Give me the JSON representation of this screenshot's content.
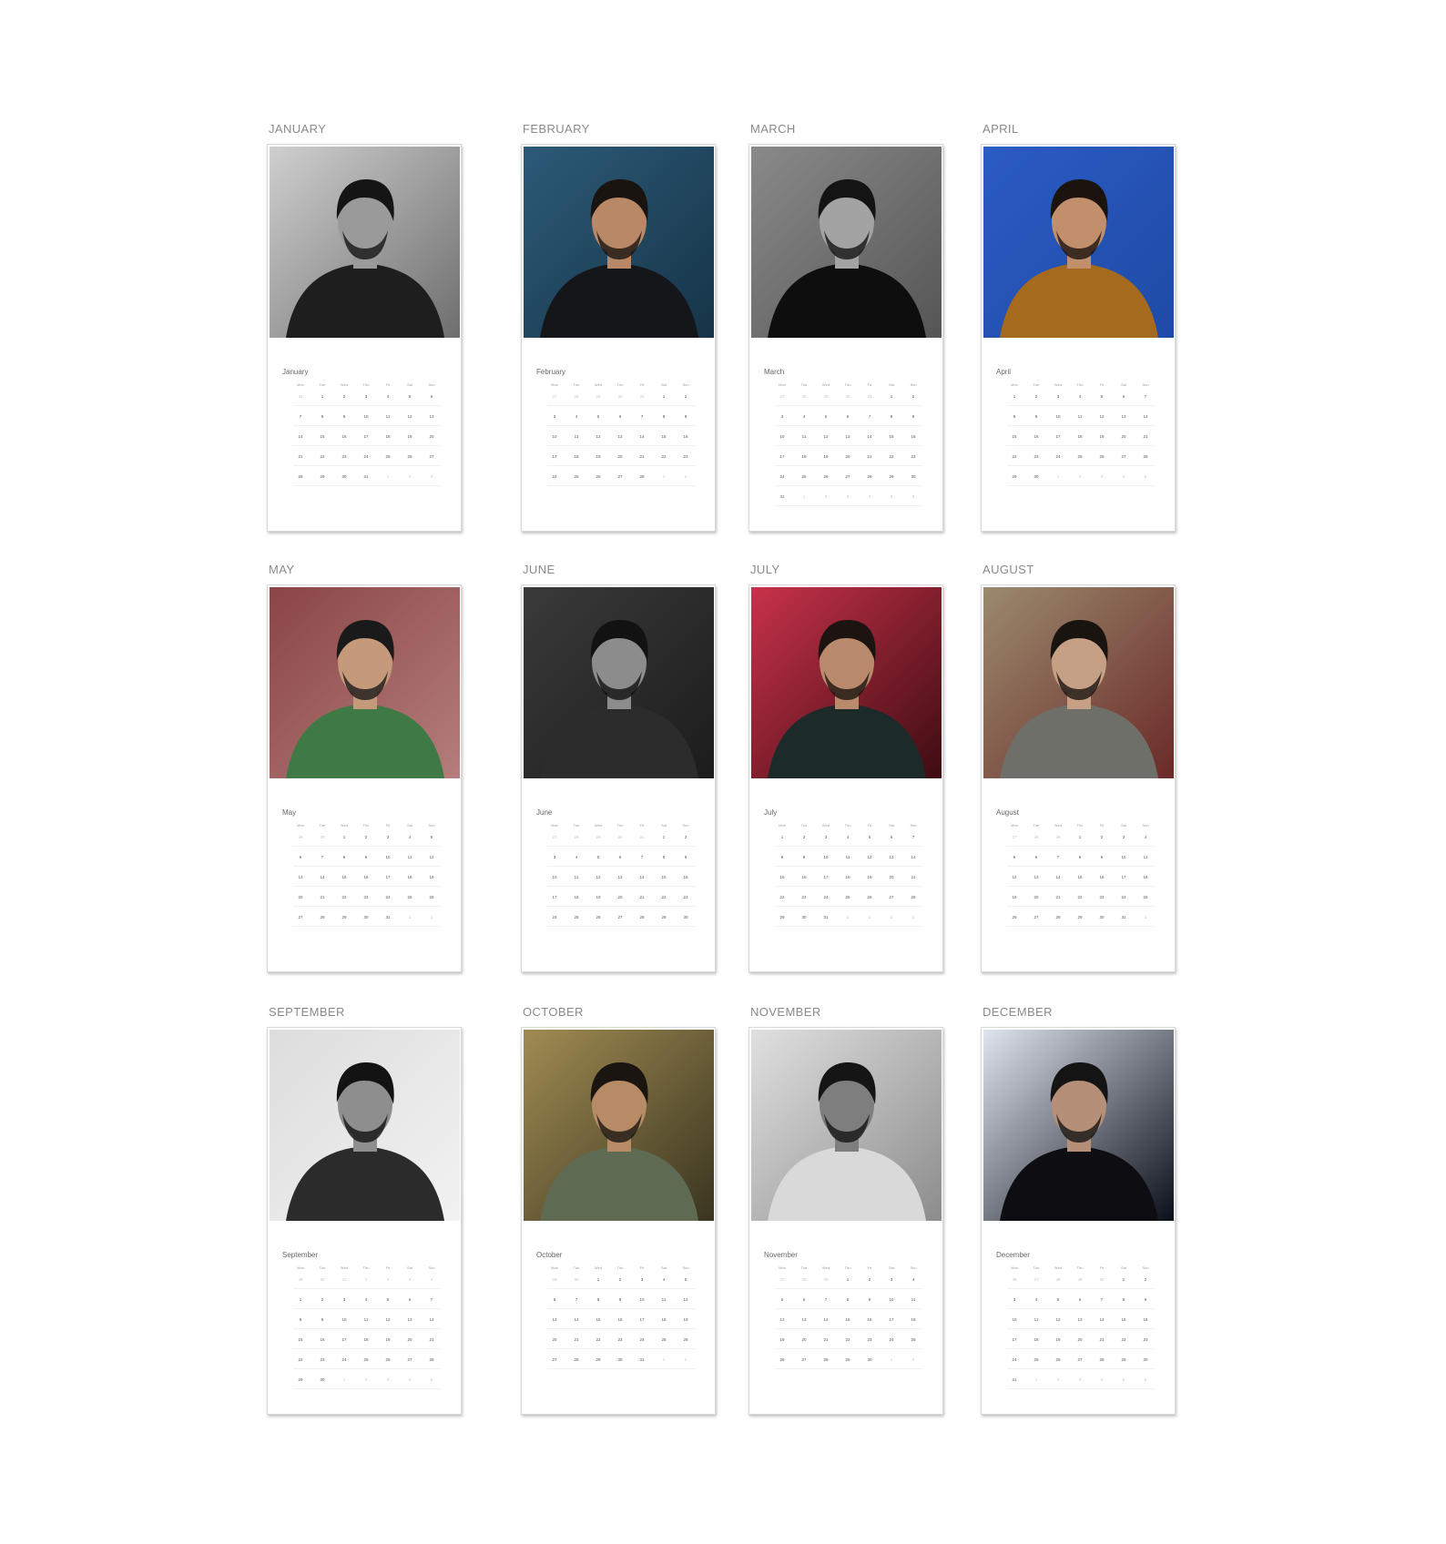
{
  "weekdays": [
    "Mon",
    "Tue",
    "Wed",
    "Thu",
    "Fri",
    "Sat",
    "Sun"
  ],
  "months": [
    {
      "heading": "JANUARY",
      "title": "January",
      "lead": [
        "31"
      ],
      "days": 31,
      "bw": true,
      "palette": {
        "bg": "#6e6e6e",
        "bg2": "#cfcfcf",
        "coat": "#1e1e1e",
        "skin": "#9a9a9a",
        "hair": "#151515"
      }
    },
    {
      "heading": "FEBRUARY",
      "title": "February",
      "lead": [
        "27",
        "28",
        "29",
        "30",
        "31"
      ],
      "days": 28,
      "bw": false,
      "palette": {
        "bg": "#163447",
        "bg2": "#2c5a78",
        "coat": "#14161a",
        "skin": "#b98867",
        "hair": "#1a1410"
      }
    },
    {
      "heading": "MARCH",
      "title": "March",
      "lead": [
        "27",
        "28",
        "29",
        "30",
        "31"
      ],
      "days": 31,
      "bw": true,
      "palette": {
        "bg": "#555555",
        "bg2": "#8a8a8a",
        "coat": "#0e0e0e",
        "skin": "#a3a3a3",
        "hair": "#141414"
      }
    },
    {
      "heading": "APRIL",
      "title": "April",
      "lead": [],
      "days": 30,
      "bw": false,
      "palette": {
        "bg": "#1f4aa6",
        "bg2": "#2b5cc4",
        "coat": "#a66a1f",
        "skin": "#c28f6d",
        "hair": "#1b130e"
      }
    },
    {
      "heading": "MAY",
      "title": "May",
      "lead": [
        "29",
        "30"
      ],
      "days": 31,
      "bw": false,
      "palette": {
        "bg": "#b57d7d",
        "bg2": "#8a4545",
        "coat": "#3f7a46",
        "skin": "#c49a7b",
        "hair": "#1a1a1a"
      }
    },
    {
      "heading": "JUNE",
      "title": "June",
      "lead": [
        "27",
        "28",
        "29",
        "30",
        "31"
      ],
      "days": 30,
      "bw": true,
      "palette": {
        "bg": "#1c1c1c",
        "bg2": "#3a3a3a",
        "coat": "#2c2c2c",
        "skin": "#8c8c8c",
        "hair": "#121212"
      }
    },
    {
      "heading": "JULY",
      "title": "July",
      "lead": [],
      "days": 31,
      "bw": false,
      "palette": {
        "bg": "#3d0c12",
        "bg2": "#c8324a",
        "coat": "#1d2a2a",
        "skin": "#b98a6c",
        "hair": "#1b1410"
      }
    },
    {
      "heading": "AUGUST",
      "title": "August",
      "lead": [
        "27",
        "28",
        "29"
      ],
      "days": 31,
      "bw": false,
      "palette": {
        "bg": "#6b2a28",
        "bg2": "#9a8a6e",
        "coat": "#6f6f6a",
        "skin": "#c5a084",
        "hair": "#1a1411"
      }
    },
    {
      "heading": "SEPTEMBER",
      "title": "September",
      "lead": [
        "29",
        "30",
        "31",
        "1",
        "2",
        "3",
        "4"
      ],
      "days": 30,
      "bw": true,
      "palette": {
        "bg": "#f2f2f2",
        "bg2": "#dddddd",
        "coat": "#2b2b2b",
        "skin": "#8e8e8e",
        "hair": "#131313"
      }
    },
    {
      "heading": "OCTOBER",
      "title": "October",
      "lead": [
        "29",
        "30"
      ],
      "days": 31,
      "bw": false,
      "palette": {
        "bg": "#3a3520",
        "bg2": "#a08b52",
        "coat": "#5f6a52",
        "skin": "#b78b66",
        "hair": "#1a1510"
      }
    },
    {
      "heading": "NOVEMBER",
      "title": "November",
      "lead": [
        "27",
        "28",
        "29"
      ],
      "days": 30,
      "bw": true,
      "palette": {
        "bg": "#8c8c8c",
        "bg2": "#e0e0e0",
        "coat": "#d9d9d9",
        "skin": "#7e7e7e",
        "hair": "#151515"
      }
    },
    {
      "heading": "DECEMBER",
      "title": "December",
      "lead": [
        "26",
        "27",
        "28",
        "29",
        "30"
      ],
      "days": 31,
      "bw": false,
      "palette": {
        "bg": "#0b0f19",
        "bg2": "#dfe4ee",
        "coat": "#0d0d12",
        "skin": "#b58f78",
        "hair": "#141414"
      }
    }
  ]
}
